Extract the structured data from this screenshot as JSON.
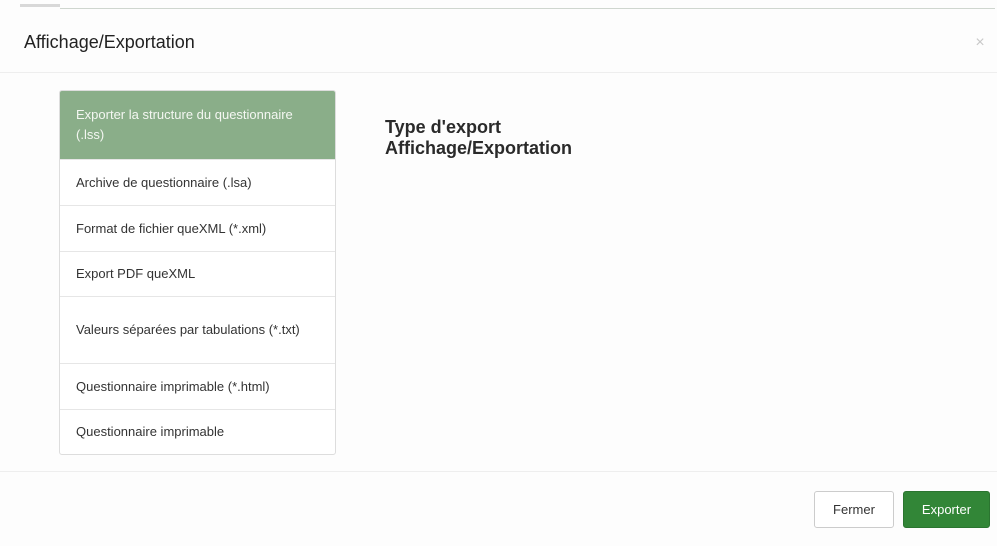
{
  "modal": {
    "title": "Affichage/Exportation",
    "close_label": "×"
  },
  "export_types": [
    {
      "label": "Exporter la structure du questionnaire (.lss)",
      "active": true
    },
    {
      "label": "Archive de questionnaire (.lsa)",
      "active": false
    },
    {
      "label": "Format de fichier queXML (*.xml)",
      "active": false
    },
    {
      "label": "Export PDF queXML",
      "active": false
    },
    {
      "label": "Valeurs séparées par tabulations (*.txt)",
      "active": false
    },
    {
      "label": "Questionnaire imprimable (*.html)",
      "active": false
    },
    {
      "label": "Questionnaire imprimable",
      "active": false
    }
  ],
  "detail": {
    "heading": "Type d'export",
    "subheading": "Affichage/Exportation"
  },
  "footer": {
    "close_button": "Fermer",
    "export_button": "Exporter"
  },
  "colors": {
    "active_item": "#8aae89",
    "export_button": "#328637"
  }
}
